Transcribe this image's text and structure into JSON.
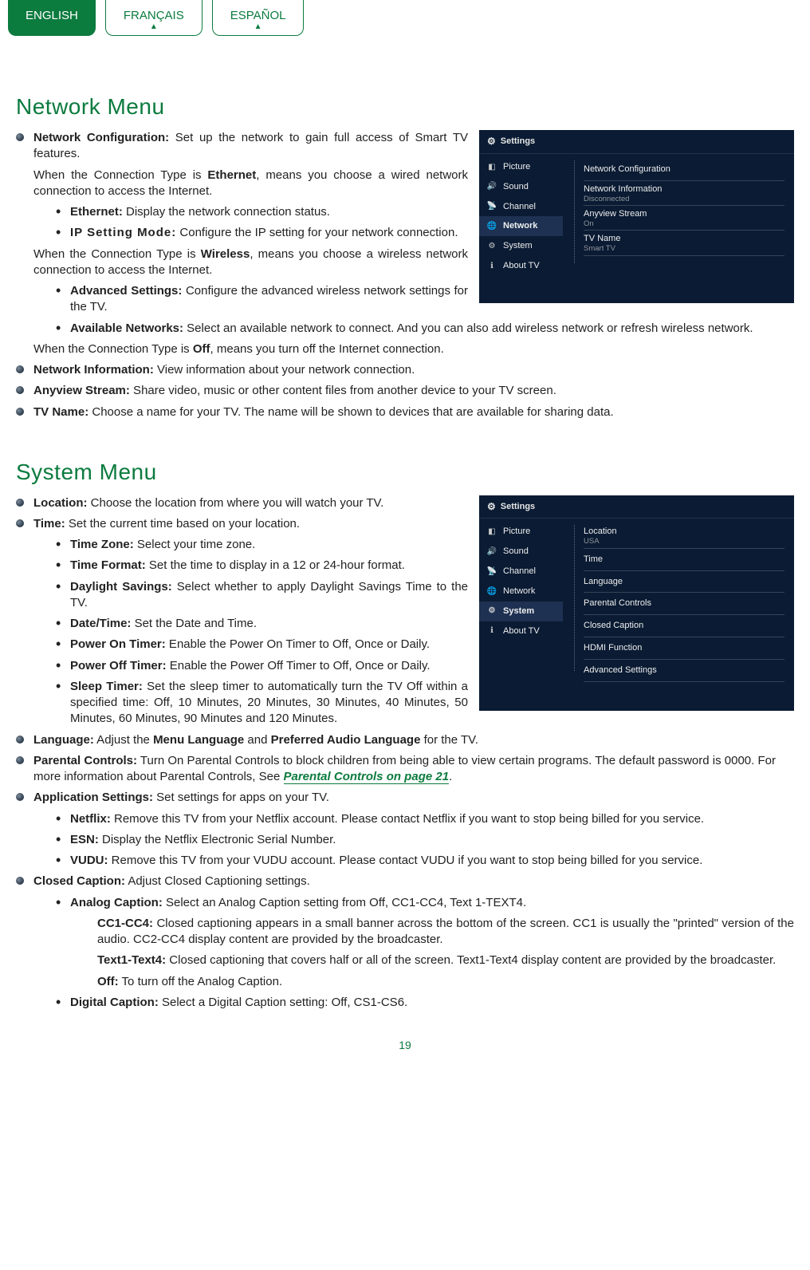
{
  "langs": {
    "english": "ENGLISH",
    "francais": "FRANÇAIS",
    "espanol": "ESPAÑOL"
  },
  "pageNumber": "19",
  "networkMenu": {
    "heading": "Network Menu",
    "items": {
      "netcfg_label": "Network Configuration:",
      "netcfg_text": " Set up the network to gain full access of Smart TV features.",
      "netcfg_eth_intro_pre": "When the Connection Type is ",
      "netcfg_eth_bold": "Ethernet",
      "netcfg_eth_intro_post": ", means you choose a wired network connection to access the Internet.",
      "eth_label": "Ethernet:",
      "eth_text": " Display the network connection status.",
      "ip_label": "IP Setting Mode:",
      "ip_text": " Configure the IP setting for your network connection.",
      "wifi_intro_pre": "When the Connection Type is ",
      "wifi_bold": "Wireless",
      "wifi_intro_post": ", means you choose a wireless network connection to access the Internet.",
      "adv_label": "Advanced Settings:",
      "adv_text": " Configure the advanced wireless network settings for the TV.",
      "avail_label": "Available Networks:",
      "avail_text": " Select an available network to connect. And you can also add wireless network or refresh wireless network.",
      "off_pre": "When the Connection Type is ",
      "off_bold": "Off",
      "off_post": ", means you turn off the Internet connection.",
      "netinfo_label": "Network Information:",
      "netinfo_text": " View information about your network connection.",
      "anyview_label": "Anyview Stream:",
      "anyview_text": " Share video, music or other content files from another device to your TV screen.",
      "tvname_label": "TV Name:",
      "tvname_text": " Choose a name for your TV. The name will be shown to devices that are available for sharing data."
    },
    "panel": {
      "title": "Settings",
      "side": [
        "Picture",
        "Sound",
        "Channel",
        "Network",
        "System",
        "About TV"
      ],
      "selected": "Network",
      "rows": [
        {
          "t": "Network Configuration",
          "v": ""
        },
        {
          "t": "Network Information",
          "v": "Disconnected"
        },
        {
          "t": "Anyview Stream",
          "v": "On"
        },
        {
          "t": "TV Name",
          "v": "Smart TV"
        }
      ]
    }
  },
  "systemMenu": {
    "heading": "System Menu",
    "items": {
      "loc_label": "Location:",
      "loc_text": " Choose the location from where you will watch your TV.",
      "time_label": "Time:",
      "time_text": " Set the current time based on your location.",
      "tz_label": "Time Zone:",
      "tz_text": " Select your time zone.",
      "tf_label": "Time Format:",
      "tf_text": " Set the time to display in a 12 or 24-hour format.",
      "ds_label": "Daylight Savings:",
      "ds_text": " Select whether to apply Daylight Savings Time to the TV.",
      "dt_label": "Date/Time:",
      "dt_text": " Set the Date and Time.",
      "pon_label": "Power On Timer:",
      "pon_text": " Enable the Power On Timer to Off, Once or Daily.",
      "poff_label": "Power Off Timer:",
      "poff_text": " Enable the Power Off Timer to Off, Once or Daily.",
      "sleep_label": "Sleep Timer:",
      "sleep_text": " Set the sleep timer to automatically turn the TV Off within a specified time: Off, 10 Minutes, 20 Minutes, 30 Minutes, 40 Minutes, 50 Minutes, 60 Minutes, 90 Minutes and 120 Minutes.",
      "lang_label": "Language:",
      "lang_pre": " Adjust the ",
      "lang_b1": "Menu Language",
      "lang_mid": " and ",
      "lang_b2": "Preferred Audio Language",
      "lang_post": " for the TV.",
      "pc_label": "Parental Controls:",
      "pc_text": " Turn On Parental Controls to block children from being able to view certain programs. The default password is 0000. For more information about Parental Controls, See ",
      "pc_link": "Parental Controls on page 21",
      "pc_end": ".",
      "app_label": "Application Settings:",
      "app_text": " Set settings for apps on your TV.",
      "netflix_label": "Netflix:",
      "netflix_text": " Remove this TV from your Netflix account. Please contact Netflix if you want to stop being billed for you service.",
      "esn_label": "ESN:",
      "esn_text": " Display the Netflix Electronic Serial Number.",
      "vudu_label": "VUDU:",
      "vudu_text": " Remove this TV from your VUDU account. Please contact VUDU if you want to stop being billed for you service.",
      "cc_label": "Closed Caption:",
      "cc_text": " Adjust Closed Captioning settings.",
      "ac_label": "Analog Caption:",
      "ac_text": " Select an Analog Caption setting from Off, CC1-CC4, Text 1-TEXT4.",
      "cc14_label": "CC1-CC4:",
      "cc14_text": " Closed captioning appears in a small banner across the bottom of the screen. CC1 is usually the \"printed\" version of the audio. CC2-CC4 display content are provided by the broadcaster.",
      "t14_label": "Text1-Text4:",
      "t14_text": " Closed captioning that covers half or all of the screen. Text1-Text4 display content are provided by the broadcaster.",
      "offc_label": "Off:",
      "offc_text": " To turn off the Analog Caption.",
      "dc_label": "Digital Caption:",
      "dc_text": " Select a Digital Caption setting: Off, CS1-CS6."
    },
    "panel": {
      "title": "Settings",
      "side": [
        "Picture",
        "Sound",
        "Channel",
        "Network",
        "System",
        "About TV"
      ],
      "selected": "System",
      "rows": [
        {
          "t": "Location",
          "v": "USA"
        },
        {
          "t": "Time",
          "v": ""
        },
        {
          "t": "Language",
          "v": ""
        },
        {
          "t": "Parental Controls",
          "v": ""
        },
        {
          "t": "Closed Caption",
          "v": ""
        },
        {
          "t": "HDMI Function",
          "v": ""
        },
        {
          "t": "Advanced Settings",
          "v": ""
        }
      ]
    }
  }
}
